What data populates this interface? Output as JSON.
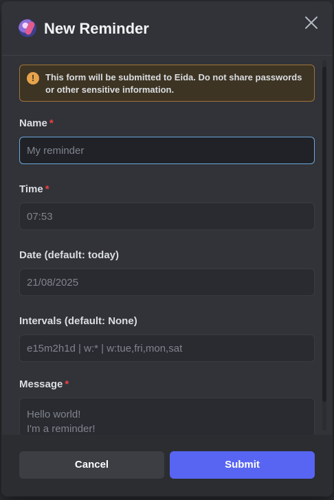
{
  "modal": {
    "title": "New Reminder",
    "warning": "This form will be submitted to Eida. Do not share passwords or other sensitive information."
  },
  "fields": {
    "name": {
      "label": "Name",
      "required_mark": "*",
      "placeholder": "My reminder"
    },
    "time": {
      "label": "Time",
      "required_mark": "*",
      "placeholder": "07:53"
    },
    "date": {
      "label": "Date (default: today)",
      "placeholder": "21/08/2025"
    },
    "intervals": {
      "label": "Intervals (default: None)",
      "placeholder": "e15m2h1d | w:* | w:tue,fri,mon,sat"
    },
    "message": {
      "label": "Message",
      "required_mark": "*",
      "placeholder": "Hello world!\nI'm a reminder!"
    }
  },
  "footer": {
    "cancel_label": "Cancel",
    "submit_label": "Submit"
  },
  "colors": {
    "accent": "#5865f2",
    "required": "#f23f43",
    "warning_border": "#a4743a",
    "focus_border": "#6ea9dd"
  }
}
